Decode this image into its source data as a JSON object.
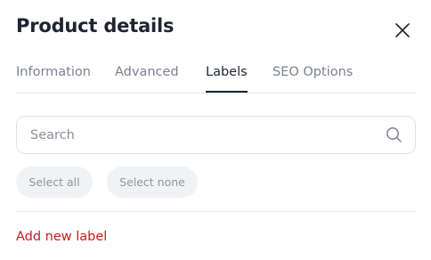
{
  "header": {
    "title": "Product details",
    "close_icon": "close-icon"
  },
  "tabs": [
    {
      "label": "Information",
      "active": false
    },
    {
      "label": "Advanced",
      "active": false
    },
    {
      "label": "Labels",
      "active": true
    },
    {
      "label": "SEO Options",
      "active": false
    }
  ],
  "search": {
    "placeholder": "Search",
    "value": "",
    "icon": "search-icon"
  },
  "actions": {
    "select_all_label": "Select all",
    "select_none_label": "Select none"
  },
  "footer": {
    "add_label": "Add new label"
  },
  "colors": {
    "text_primary": "#1e2530",
    "text_muted": "#7b818c",
    "accent_red": "#c0201c",
    "pill_bg": "#f1f2f4",
    "border": "#e6e8ec"
  }
}
